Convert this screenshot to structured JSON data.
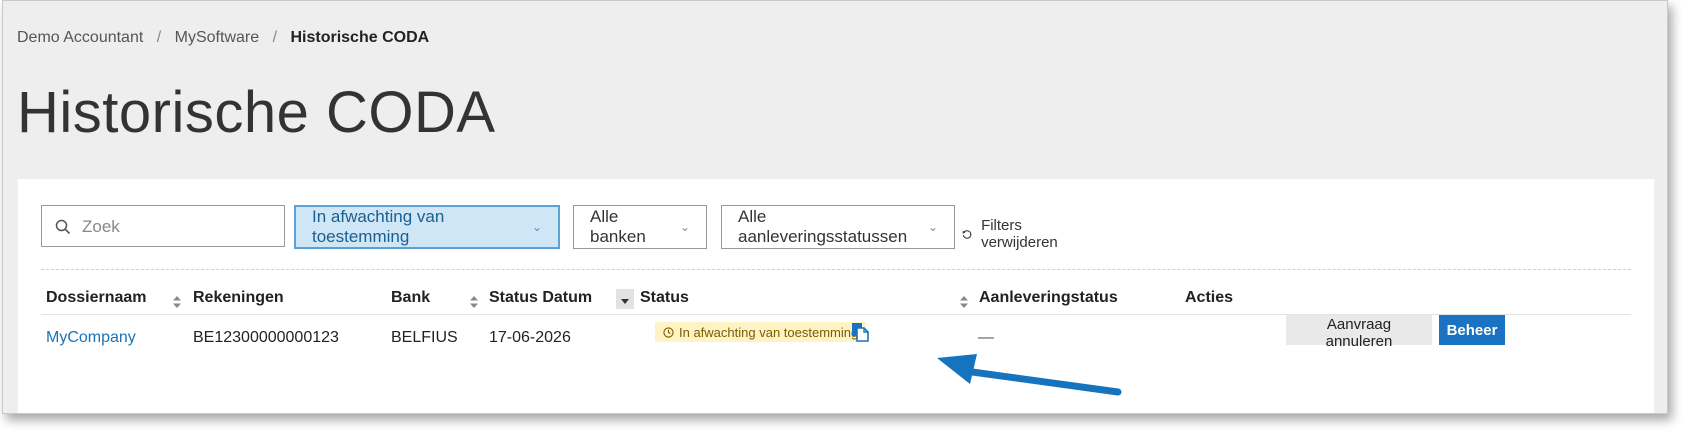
{
  "breadcrumb": {
    "items": [
      "Demo Accountant",
      "MySoftware"
    ],
    "current": "Historische CODA",
    "separator": "/"
  },
  "page_title": "Historische CODA",
  "filters": {
    "search_placeholder": "Zoek",
    "status_filter": "In afwachting van toestemming",
    "bank_filter": "Alle banken",
    "delivery_filter": "Alle aanleveringsstatussen",
    "reset_label": "Filters verwijderen"
  },
  "table": {
    "columns": [
      "Dossiernaam",
      "Rekeningen",
      "Bank",
      "Status Datum",
      "Status",
      "Aanleveringstatus",
      "Acties"
    ],
    "rows": [
      {
        "dossier": "MyCompany",
        "account": "BE12300000000123",
        "bank": "BELFIUS",
        "status_date": "17-06-2026",
        "status": "In afwachting van toestemming",
        "delivery_status": "—",
        "actions": {
          "cancel": "Aanvraag annuleren",
          "manage": "Beheer"
        }
      }
    ]
  },
  "colors": {
    "accent": "#1a73c2",
    "link": "#1a73b5",
    "badge_bg": "#fdf3c4",
    "badge_text": "#7a5c00",
    "active_filter_bg": "#cfe6f6",
    "annotation_arrow": "#1574bd"
  },
  "icons": [
    "search-icon",
    "chevron-down-icon",
    "reset-icon",
    "sort-icon",
    "clock-icon",
    "copy-icon",
    "annotation-arrow"
  ]
}
